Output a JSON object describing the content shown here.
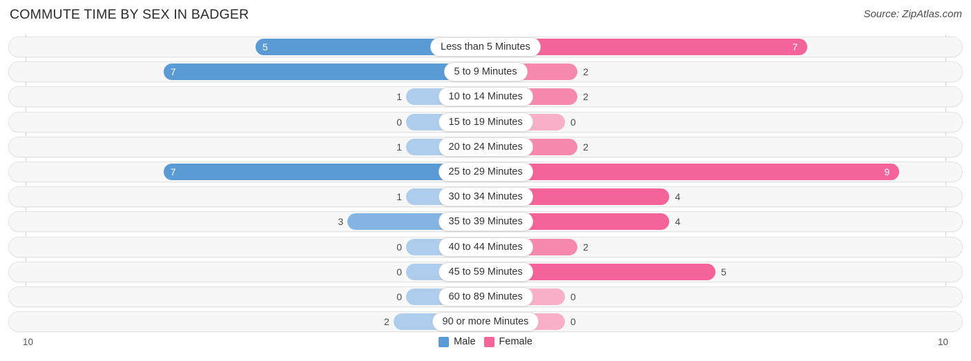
{
  "header": {
    "title": "COMMUTE TIME BY SEX IN BADGER",
    "source": "Source: ZipAtlas.com"
  },
  "axis": {
    "left_label": "10",
    "right_label": "10"
  },
  "legend": {
    "items": [
      {
        "label": "Male",
        "color": "#5B9BD5"
      },
      {
        "label": "Female",
        "color": "#F4649B"
      }
    ]
  },
  "colors": {
    "male_strong": "#5B9BD5",
    "male_mid": "#84B4E2",
    "male_light": "#AECDEC",
    "female_strong": "#F4649B",
    "female_mid": "#F789AF",
    "female_light": "#F9AFC8",
    "track": "#f7f7f7",
    "gridline": "#d9d9d9"
  },
  "chart_data": {
    "type": "bar",
    "subtype": "diverging-bidirectional-bar",
    "title": "COMMUTE TIME BY SEX IN BADGER",
    "xlabel": "",
    "ylabel": "",
    "axis_max_per_side": 10,
    "xlim": [
      -10,
      10
    ],
    "grid": true,
    "legend_position": "bottom-center",
    "categories": [
      "Less than 5 Minutes",
      "5 to 9 Minutes",
      "10 to 14 Minutes",
      "15 to 19 Minutes",
      "20 to 24 Minutes",
      "25 to 29 Minutes",
      "30 to 34 Minutes",
      "35 to 39 Minutes",
      "40 to 44 Minutes",
      "45 to 59 Minutes",
      "60 to 89 Minutes",
      "90 or more Minutes"
    ],
    "series": [
      {
        "name": "Male",
        "direction": "left",
        "color": "#5B9BD5",
        "values": [
          5,
          7,
          1,
          0,
          1,
          7,
          1,
          3,
          0,
          0,
          0,
          2
        ]
      },
      {
        "name": "Female",
        "direction": "right",
        "color": "#F4649B",
        "values": [
          7,
          2,
          2,
          0,
          2,
          9,
          4,
          4,
          2,
          5,
          0,
          0
        ]
      }
    ]
  }
}
